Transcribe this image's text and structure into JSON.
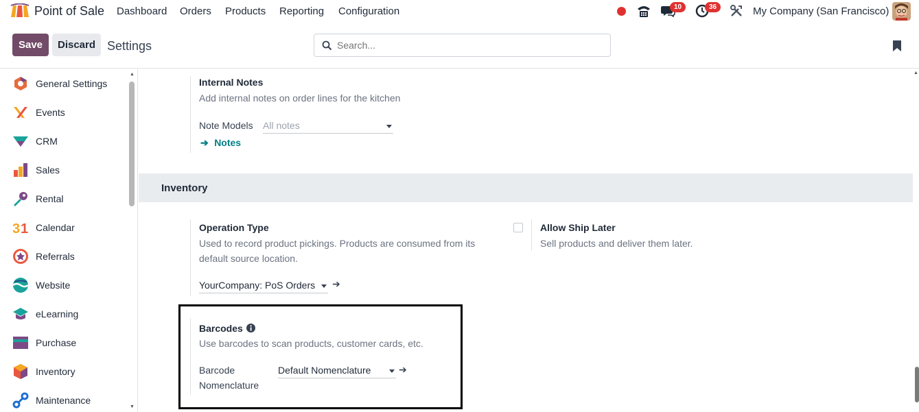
{
  "navbar": {
    "app_name": "Point of Sale",
    "menu": [
      "Dashboard",
      "Orders",
      "Products",
      "Reporting",
      "Configuration"
    ],
    "chat_badge": "10",
    "activity_badge": "36",
    "company": "My Company (San Francisco)"
  },
  "controls": {
    "save_label": "Save",
    "discard_label": "Discard",
    "breadcrumb": "Settings",
    "search_placeholder": "Search..."
  },
  "sidebar": {
    "items": [
      {
        "label": "General Settings",
        "icon": "general-settings-icon"
      },
      {
        "label": "Events",
        "icon": "events-icon"
      },
      {
        "label": "CRM",
        "icon": "crm-icon"
      },
      {
        "label": "Sales",
        "icon": "sales-icon"
      },
      {
        "label": "Rental",
        "icon": "rental-icon"
      },
      {
        "label": "Calendar",
        "icon": "calendar-icon"
      },
      {
        "label": "Referrals",
        "icon": "referrals-icon"
      },
      {
        "label": "Website",
        "icon": "website-icon"
      },
      {
        "label": "eLearning",
        "icon": "elearning-icon"
      },
      {
        "label": "Purchase",
        "icon": "purchase-icon"
      },
      {
        "label": "Inventory",
        "icon": "inventory-icon"
      },
      {
        "label": "Maintenance",
        "icon": "maintenance-icon"
      }
    ]
  },
  "internal_notes": {
    "title": "Internal Notes",
    "description": "Add internal notes on order lines for the kitchen",
    "field_label": "Note Models",
    "field_placeholder": "All notes",
    "link_label": "Notes"
  },
  "inventory": {
    "section_title": "Inventory",
    "operation_type": {
      "title": "Operation Type",
      "description_line1": "Used to record product pickings. Products are consumed from its",
      "description_line2": "default source location.",
      "value": "YourCompany: PoS Orders"
    },
    "allow_ship_later": {
      "title": "Allow Ship Later",
      "description": "Sell products and deliver them later.",
      "checked": false
    },
    "barcodes": {
      "title": "Barcodes",
      "description": "Use barcodes to scan products, customer cards, etc.",
      "field_label_line1": "Barcode",
      "field_label_line2": "Nomenclature",
      "value": "Default Nomenclature"
    }
  },
  "colors": {
    "primary": "#714b67",
    "link": "#017e84",
    "section_bg": "#e9ecef",
    "badge": "#e03131"
  }
}
